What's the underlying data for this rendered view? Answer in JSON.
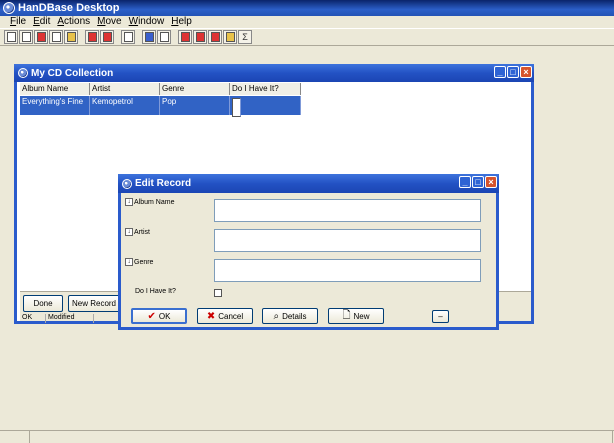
{
  "app": {
    "title": "HanDBase Desktop"
  },
  "menu": [
    {
      "label": "File",
      "key": "F",
      "rest": "ile"
    },
    {
      "label": "Edit",
      "key": "E",
      "rest": "dit"
    },
    {
      "label": "Actions",
      "key": "A",
      "rest": "ctions"
    },
    {
      "label": "Move",
      "key": "M",
      "rest": "ove"
    },
    {
      "label": "Window",
      "key": "W",
      "rest": "indow"
    },
    {
      "label": "Help",
      "key": "H",
      "rest": "elp"
    }
  ],
  "toolbar": {
    "icons": [
      "new-file-icon",
      "open-file-icon",
      "save-icon",
      "copy-db-icon",
      "import-icon",
      "export-icon",
      "sync-icon",
      "print-icon",
      "view-icon",
      "grid-icon",
      "filter-icon",
      "sort-icon",
      "find-icon",
      "replace-icon",
      "sigma-icon"
    ]
  },
  "cd_window": {
    "title": "My CD Collection",
    "columns": [
      "Album Name",
      "Artist",
      "Genre",
      "Do I Have It?"
    ],
    "rows": [
      {
        "album": "Everything's Fine",
        "artist": "Kemopetrol",
        "genre": "Pop",
        "have": false
      }
    ],
    "done_label": "Done",
    "new_record_label": "New Record",
    "status_ok": "OK",
    "status_modified": "Modified"
  },
  "dialog": {
    "title": "Edit Record",
    "fields": [
      {
        "label": "Album Name",
        "value": ""
      },
      {
        "label": "Artist",
        "value": ""
      },
      {
        "label": "Genre",
        "value": ""
      }
    ],
    "checkbox_label": "Do I Have It?",
    "buttons": {
      "ok": "OK",
      "cancel": "Cancel",
      "details": "Details",
      "new": "New",
      "minus": "–"
    }
  }
}
